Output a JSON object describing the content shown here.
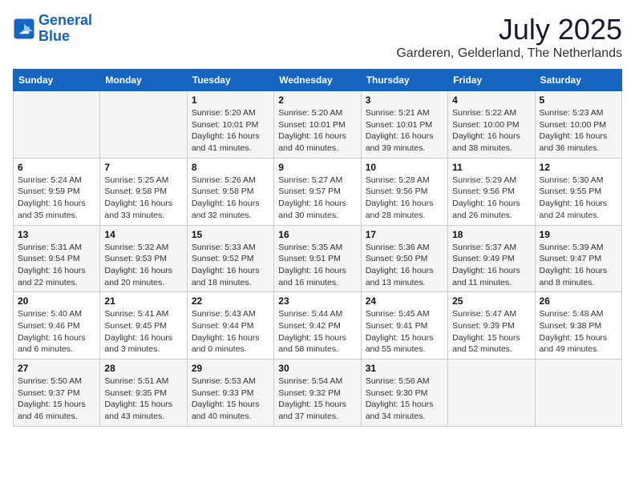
{
  "logo": {
    "line1": "General",
    "line2": "Blue"
  },
  "title": "July 2025",
  "location": "Garderen, Gelderland, The Netherlands",
  "header": {
    "days": [
      "Sunday",
      "Monday",
      "Tuesday",
      "Wednesday",
      "Thursday",
      "Friday",
      "Saturday"
    ]
  },
  "weeks": [
    [
      {
        "day": "",
        "text": ""
      },
      {
        "day": "",
        "text": ""
      },
      {
        "day": "1",
        "text": "Sunrise: 5:20 AM\nSunset: 10:01 PM\nDaylight: 16 hours\nand 41 minutes."
      },
      {
        "day": "2",
        "text": "Sunrise: 5:20 AM\nSunset: 10:01 PM\nDaylight: 16 hours\nand 40 minutes."
      },
      {
        "day": "3",
        "text": "Sunrise: 5:21 AM\nSunset: 10:01 PM\nDaylight: 16 hours\nand 39 minutes."
      },
      {
        "day": "4",
        "text": "Sunrise: 5:22 AM\nSunset: 10:00 PM\nDaylight: 16 hours\nand 38 minutes."
      },
      {
        "day": "5",
        "text": "Sunrise: 5:23 AM\nSunset: 10:00 PM\nDaylight: 16 hours\nand 36 minutes."
      }
    ],
    [
      {
        "day": "6",
        "text": "Sunrise: 5:24 AM\nSunset: 9:59 PM\nDaylight: 16 hours\nand 35 minutes."
      },
      {
        "day": "7",
        "text": "Sunrise: 5:25 AM\nSunset: 9:58 PM\nDaylight: 16 hours\nand 33 minutes."
      },
      {
        "day": "8",
        "text": "Sunrise: 5:26 AM\nSunset: 9:58 PM\nDaylight: 16 hours\nand 32 minutes."
      },
      {
        "day": "9",
        "text": "Sunrise: 5:27 AM\nSunset: 9:57 PM\nDaylight: 16 hours\nand 30 minutes."
      },
      {
        "day": "10",
        "text": "Sunrise: 5:28 AM\nSunset: 9:56 PM\nDaylight: 16 hours\nand 28 minutes."
      },
      {
        "day": "11",
        "text": "Sunrise: 5:29 AM\nSunset: 9:56 PM\nDaylight: 16 hours\nand 26 minutes."
      },
      {
        "day": "12",
        "text": "Sunrise: 5:30 AM\nSunset: 9:55 PM\nDaylight: 16 hours\nand 24 minutes."
      }
    ],
    [
      {
        "day": "13",
        "text": "Sunrise: 5:31 AM\nSunset: 9:54 PM\nDaylight: 16 hours\nand 22 minutes."
      },
      {
        "day": "14",
        "text": "Sunrise: 5:32 AM\nSunset: 9:53 PM\nDaylight: 16 hours\nand 20 minutes."
      },
      {
        "day": "15",
        "text": "Sunrise: 5:33 AM\nSunset: 9:52 PM\nDaylight: 16 hours\nand 18 minutes."
      },
      {
        "day": "16",
        "text": "Sunrise: 5:35 AM\nSunset: 9:51 PM\nDaylight: 16 hours\nand 16 minutes."
      },
      {
        "day": "17",
        "text": "Sunrise: 5:36 AM\nSunset: 9:50 PM\nDaylight: 16 hours\nand 13 minutes."
      },
      {
        "day": "18",
        "text": "Sunrise: 5:37 AM\nSunset: 9:49 PM\nDaylight: 16 hours\nand 11 minutes."
      },
      {
        "day": "19",
        "text": "Sunrise: 5:39 AM\nSunset: 9:47 PM\nDaylight: 16 hours\nand 8 minutes."
      }
    ],
    [
      {
        "day": "20",
        "text": "Sunrise: 5:40 AM\nSunset: 9:46 PM\nDaylight: 16 hours\nand 6 minutes."
      },
      {
        "day": "21",
        "text": "Sunrise: 5:41 AM\nSunset: 9:45 PM\nDaylight: 16 hours\nand 3 minutes."
      },
      {
        "day": "22",
        "text": "Sunrise: 5:43 AM\nSunset: 9:44 PM\nDaylight: 16 hours\nand 0 minutes."
      },
      {
        "day": "23",
        "text": "Sunrise: 5:44 AM\nSunset: 9:42 PM\nDaylight: 15 hours\nand 58 minutes."
      },
      {
        "day": "24",
        "text": "Sunrise: 5:45 AM\nSunset: 9:41 PM\nDaylight: 15 hours\nand 55 minutes."
      },
      {
        "day": "25",
        "text": "Sunrise: 5:47 AM\nSunset: 9:39 PM\nDaylight: 15 hours\nand 52 minutes."
      },
      {
        "day": "26",
        "text": "Sunrise: 5:48 AM\nSunset: 9:38 PM\nDaylight: 15 hours\nand 49 minutes."
      }
    ],
    [
      {
        "day": "27",
        "text": "Sunrise: 5:50 AM\nSunset: 9:37 PM\nDaylight: 15 hours\nand 46 minutes."
      },
      {
        "day": "28",
        "text": "Sunrise: 5:51 AM\nSunset: 9:35 PM\nDaylight: 15 hours\nand 43 minutes."
      },
      {
        "day": "29",
        "text": "Sunrise: 5:53 AM\nSunset: 9:33 PM\nDaylight: 15 hours\nand 40 minutes."
      },
      {
        "day": "30",
        "text": "Sunrise: 5:54 AM\nSunset: 9:32 PM\nDaylight: 15 hours\nand 37 minutes."
      },
      {
        "day": "31",
        "text": "Sunrise: 5:56 AM\nSunset: 9:30 PM\nDaylight: 15 hours\nand 34 minutes."
      },
      {
        "day": "",
        "text": ""
      },
      {
        "day": "",
        "text": ""
      }
    ]
  ]
}
